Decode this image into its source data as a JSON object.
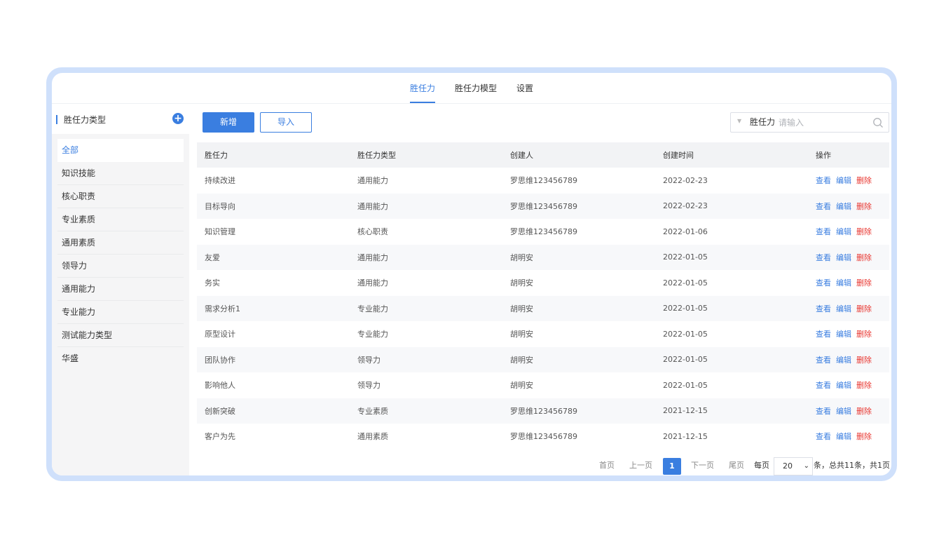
{
  "tabs": [
    "胜任力",
    "胜任力模型",
    "设置"
  ],
  "sidebar": {
    "title": "胜任力类型",
    "add_icon": "plus-circle-icon",
    "items": [
      "全部",
      "知识技能",
      "核心职责",
      "专业素质",
      "通用素质",
      "领导力",
      "通用能力",
      "专业能力",
      "测试能力类型",
      "华盛"
    ]
  },
  "toolbar": {
    "add_label": "新增",
    "import_label": "导入"
  },
  "search": {
    "field_label": "胜任力",
    "placeholder": "请输入",
    "icon": "search-icon"
  },
  "table": {
    "columns": [
      "胜任力",
      "胜任力类型",
      "创建人",
      "创建时间",
      "操作"
    ],
    "actions": {
      "view": "查看",
      "edit": "编辑",
      "delete": "删除"
    },
    "rows": [
      [
        "持续改进",
        "通用能力",
        "罗思维123456789",
        "2022-02-23"
      ],
      [
        "目标导向",
        "通用能力",
        "罗思维123456789",
        "2022-02-23"
      ],
      [
        "知识管理",
        "核心职责",
        "罗思维123456789",
        "2022-01-06"
      ],
      [
        "友爱",
        "通用能力",
        "胡明安",
        "2022-01-05"
      ],
      [
        "务实",
        "通用能力",
        "胡明安",
        "2022-01-05"
      ],
      [
        "需求分析1",
        "专业能力",
        "胡明安",
        "2022-01-05"
      ],
      [
        "原型设计",
        "专业能力",
        "胡明安",
        "2022-01-05"
      ],
      [
        "团队协作",
        "领导力",
        "胡明安",
        "2022-01-05"
      ],
      [
        "影响他人",
        "领导力",
        "胡明安",
        "2022-01-05"
      ],
      [
        "创新突破",
        "专业素质",
        "罗思维123456789",
        "2021-12-15"
      ],
      [
        "客户为先",
        "通用素质",
        "罗思维123456789",
        "2021-12-15"
      ]
    ]
  },
  "pagination": {
    "first": "首页",
    "prev": "上一页",
    "current": "1",
    "next": "下一页",
    "last": "尾页",
    "per_page_label": "每页",
    "page_size": "20",
    "summary": "条，总共11条，共1页"
  },
  "colors": {
    "accent": "#3a7ee0",
    "danger": "#e8352f",
    "frame": "#cfe0fb"
  }
}
